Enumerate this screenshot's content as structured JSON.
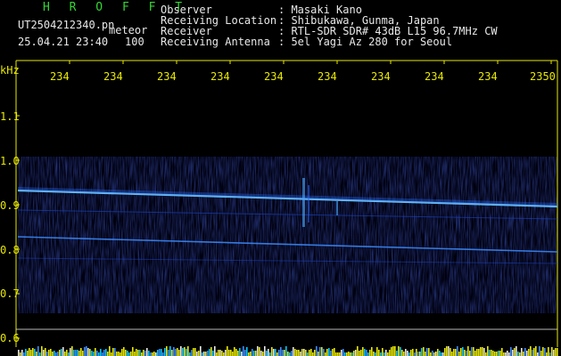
{
  "header": {
    "brand": "H R O F F T",
    "file_name": "UT2504212340.pn",
    "tag": "meteor",
    "datetime": "25.04.21 23:40",
    "count": "100",
    "fields": [
      {
        "label": "Observer",
        "value": ": Masaki Kano"
      },
      {
        "label": "Receiving Location",
        "value": ": Shibukawa, Gunma, Japan"
      },
      {
        "label": "Receiver",
        "value": ": RTL-SDR SDR# 43dB L15 96.7MHz CW"
      },
      {
        "label": "Receiving Antenna",
        "value": ": 5el Yagi Az 280 for Seoul"
      }
    ]
  },
  "spectrogram": {
    "unit_label": "kHz",
    "y_ticks": [
      "1.1",
      "1.0",
      "0.9",
      "0.8",
      "0.7",
      "0.6"
    ],
    "x_ticks": [
      "234",
      "234",
      "234",
      "234",
      "234",
      "234",
      "234",
      "234",
      "234",
      "2350"
    ],
    "colors": {
      "axis": "#e8e800",
      "trace": "#4aa8ff",
      "background": "#000010"
    }
  }
}
